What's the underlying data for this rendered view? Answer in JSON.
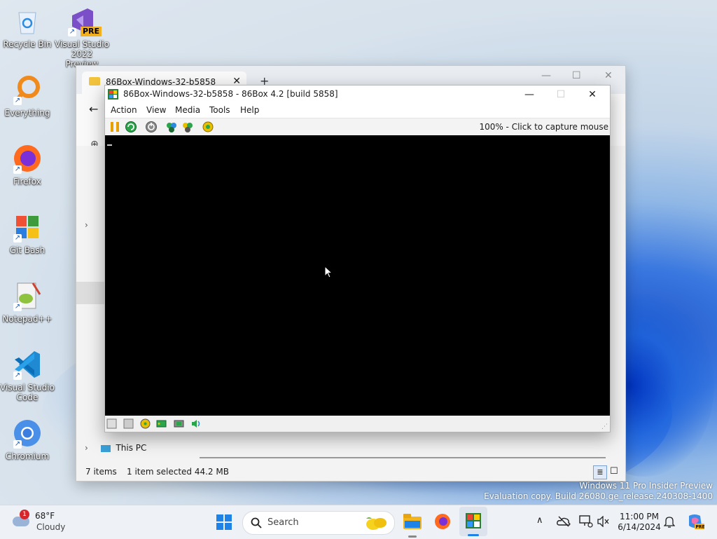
{
  "desktop": {
    "icons": [
      {
        "label": "Recycle Bin"
      },
      {
        "label": "Visual Studio 2022 Preview",
        "badge": "PRE"
      },
      {
        "label": "Everything"
      },
      {
        "label": "Firefox"
      },
      {
        "label": "Git Bash"
      },
      {
        "label": "Notepad++"
      },
      {
        "label": "Visual Studio Code"
      },
      {
        "label": "Chromium"
      }
    ]
  },
  "explorer": {
    "tab_title": "86Box-Windows-32-b5858",
    "sidebar_this_pc": "This PC",
    "status_items": "7 items",
    "status_selected": "1 item selected  44.2 MB"
  },
  "box86": {
    "title": "86Box-Windows-32-b5858 - 86Box 4.2 [build 5858]",
    "menu": [
      "Action",
      "View",
      "Media",
      "Tools",
      "Help"
    ],
    "capture_text": "100% - Click to capture mouse",
    "colors": {
      "screen": "#000000",
      "pause": "#e8a000",
      "accent": "#1d8a3a"
    }
  },
  "taskbar": {
    "weather_temp": "68°F",
    "weather_desc": "Cloudy",
    "weather_badge": "1",
    "search_label": "Search",
    "time": "11:00 PM",
    "date": "6/14/2024"
  },
  "watermark": {
    "line1": "Windows 11 Pro Insider Preview",
    "line2": "Evaluation copy. Build 26080.ge_release.240308-1400"
  }
}
